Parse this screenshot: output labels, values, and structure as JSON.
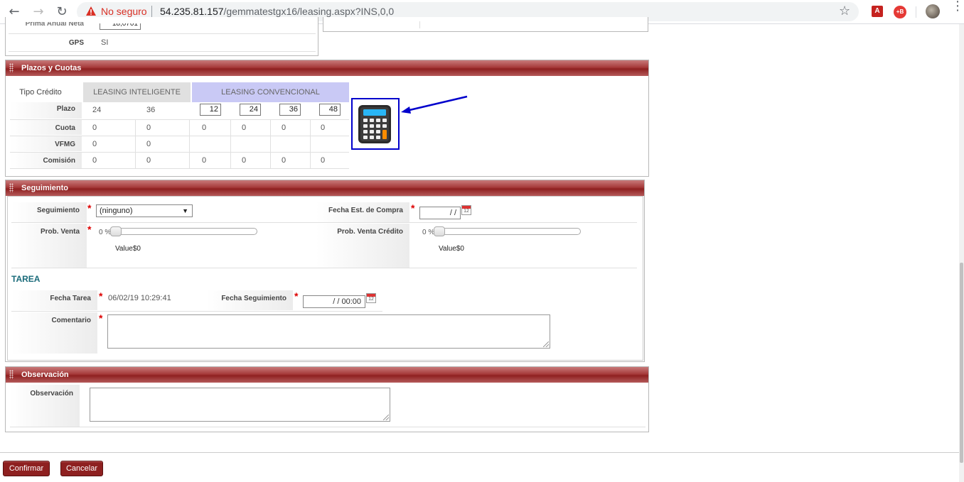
{
  "browser": {
    "security_label": "No seguro",
    "url_host": "54.235.81.157",
    "url_path": "/gemmatestgx16/leasing.aspx?INS,0,0"
  },
  "top_section": {
    "prima_label": "Prima Anual Neta",
    "prima_value": "18,0701",
    "gps_label": "GPS",
    "gps_value": "SI"
  },
  "plazos": {
    "header": "Plazos y Cuotas",
    "tipo_credito_label": "Tipo Crédito",
    "tab_inteligente": "LEASING INTELIGENTE",
    "tab_convencional": "LEASING CONVENCIONAL",
    "rows": {
      "plazo_label": "Plazo",
      "cuota_label": "Cuota",
      "vfmg_label": "VFMG",
      "comision_label": "Comisión"
    },
    "inteligente": {
      "plazo": [
        "24",
        "36"
      ],
      "cuota": [
        "0",
        "0"
      ],
      "vfmg": [
        "0",
        "0"
      ],
      "comision": [
        "0",
        "0"
      ]
    },
    "convencional": {
      "plazo": [
        "12",
        "24",
        "36",
        "48"
      ],
      "cuota": [
        "0",
        "0",
        "0",
        "0"
      ],
      "comision": [
        "0",
        "0",
        "0",
        "0"
      ]
    },
    "calculator_icon": "calculator-icon"
  },
  "seguimiento": {
    "header": "Seguimiento",
    "seguimiento_label": "Seguimiento",
    "seguimiento_value": "(ninguno)",
    "fecha_compra_label": "Fecha Est. de Compra",
    "fecha_compra_value": "/ /",
    "prob_venta_label": "Prob. Venta",
    "prob_venta_value": "0 %",
    "prob_venta_level": 0,
    "prob_venta_caption": "Value$0",
    "prob_credito_label": "Prob. Venta Crédito",
    "prob_credito_value": "0 %",
    "prob_credito_level": 0,
    "prob_credito_caption": "Value$0",
    "tarea_title": "TAREA",
    "fecha_tarea_label": "Fecha Tarea",
    "fecha_tarea_value": "06/02/19 10:29:41",
    "fecha_seguimiento_label": "Fecha Seguimiento",
    "fecha_seguimiento_value": "/ /  00:00",
    "comentario_label": "Comentario"
  },
  "observacion": {
    "header": "Observación",
    "label": "Observación"
  },
  "actions": {
    "confirm": "Confirmar",
    "cancel": "Cancelar"
  },
  "colors": {
    "header_red": "#8e2020",
    "tab_convencional": "#c9c9f5",
    "tab_inteligente": "#e0e0e0",
    "annotation_blue": "#0000cc",
    "tarea_teal": "#1a6b7a"
  }
}
